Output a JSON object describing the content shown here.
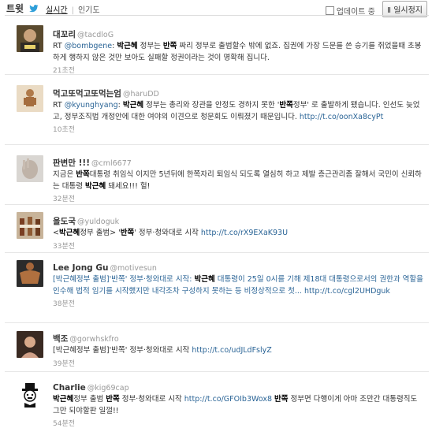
{
  "header": {
    "title": "트윗",
    "tabs": [
      "실시간",
      "인기도"
    ],
    "update_label": "업데이트 중",
    "pause_label": "일시정지",
    "colors": {
      "link": "#2a6496",
      "bird": "#2f9fd9"
    }
  },
  "tweets": [
    {
      "name": "대꼬리",
      "handle": "@tacdloG",
      "time": "21초전",
      "parts": [
        {
          "t": "RT "
        },
        {
          "t": "@bombgene",
          "link": true
        },
        {
          "t": ": "
        },
        {
          "t": "박근혜",
          "b": true
        },
        {
          "t": " 정부는 "
        },
        {
          "t": "반쪽",
          "b": true
        },
        {
          "t": " 짜리 정부로 출범할수 밖에 없죠. 집권에 가장 드문를 쓴 승기를 쥐었을때 초봉하게 행하지 않은 것만 보아도 실패할 정권이라는 것이 명확해 집니다."
        }
      ],
      "avatar_icon": "person-photo-icon"
    },
    {
      "name": "먹고또먹고또먹는엄",
      "handle": "@haruDD",
      "time": "10초전",
      "parts": [
        {
          "t": "RT "
        },
        {
          "t": "@kyunghyang",
          "link": true
        },
        {
          "t": ": "
        },
        {
          "t": "박근혜",
          "b": true
        },
        {
          "t": " 정부는 총리와 장관을 안정도 경하지 못한 '"
        },
        {
          "t": "반쪽",
          "b": true
        },
        {
          "t": "정부' 로 출발하게 됐습니다. 인선도 늦었고, 정부조직법 개정안에 대한 여야의 이견으로 청문회도 이뤄졌기 때문입니다. "
        },
        {
          "t": "http://t.co/oonXa8cyPt",
          "link": true
        }
      ],
      "avatar_icon": "wooden-figure-icon"
    },
    {
      "name": "판변만 !!!",
      "handle": "@cml6677",
      "time": "32분전",
      "parts": [
        {
          "t": "지금은 "
        },
        {
          "t": "반쪽",
          "b": true
        },
        {
          "t": "대통령 취임식 이지만 5년뒤에 한쪽자리 퇴임식 되도록 열심히 하고 제발 층근관리좀 잘해서 국민이 신뢰하는 대통령 "
        },
        {
          "t": "박근혜",
          "b": true
        },
        {
          "t": " 돼세요!!! 헐!"
        }
      ],
      "avatar_icon": "hand-photo-icon"
    },
    {
      "name": "을도국",
      "handle": "@yuldoguk",
      "time": "33분전",
      "parts": [
        {
          "t": "<"
        },
        {
          "t": "박근혜",
          "b": true
        },
        {
          "t": "정부 출범> '"
        },
        {
          "t": "반쪽",
          "b": true
        },
        {
          "t": "' 정부·청와대로 시작 "
        },
        {
          "t": "http://t.co/rX9EXaK93U",
          "link": true
        }
      ],
      "avatar_icon": "bottles-photo-icon"
    },
    {
      "name": "Lee Jong Gu",
      "handle": "@motivesun",
      "time": "38분전",
      "parts": [
        {
          "t": "[박근혜정부 출범]'반쪽' 정부·청와대로 시작: ",
          "link": true
        },
        {
          "t": "박근혜",
          "b": true
        },
        {
          "t": " 대통령이 25일 0시를 기해 제18대 대통령으로서의 권한과 역할을 인수해 법적 임기를 시작했지만 내각조차 구성하지 못하는 등 비정상적으로 첫... ",
          "link": true
        },
        {
          "t": "http://t.co/cgl2UHDguk",
          "link": true
        }
      ],
      "avatar_icon": "bodybuilder-photo-icon"
    },
    {
      "name": "백조",
      "handle": "@gorwhskfro",
      "time": "39분전",
      "parts": [
        {
          "t": "[박근혜정부 출범]'반쪽' 정부·청와대로 시작 "
        },
        {
          "t": "http://t.co/udJLdFslyZ",
          "link": true
        }
      ],
      "avatar_icon": "woman-photo-icon"
    },
    {
      "name": "Charlie",
      "handle": "@kig69cap",
      "time": "54분전",
      "parts": [
        {
          "t": "박근혜",
          "b": true
        },
        {
          "t": "정부 출범 "
        },
        {
          "t": "반쪽",
          "b": true
        },
        {
          "t": " 정부·청와대로 시작 "
        },
        {
          "t": "http://t.co/GFOIb3Wox8",
          "link": true
        },
        {
          "t": " "
        },
        {
          "t": "반쪽",
          "b": true
        },
        {
          "t": " 정부면 다행이게 아마 조만간 대통령직도 그만 되야할판 일껄!!"
        }
      ],
      "avatar_icon": "charlie-chaplin-icon"
    }
  ]
}
